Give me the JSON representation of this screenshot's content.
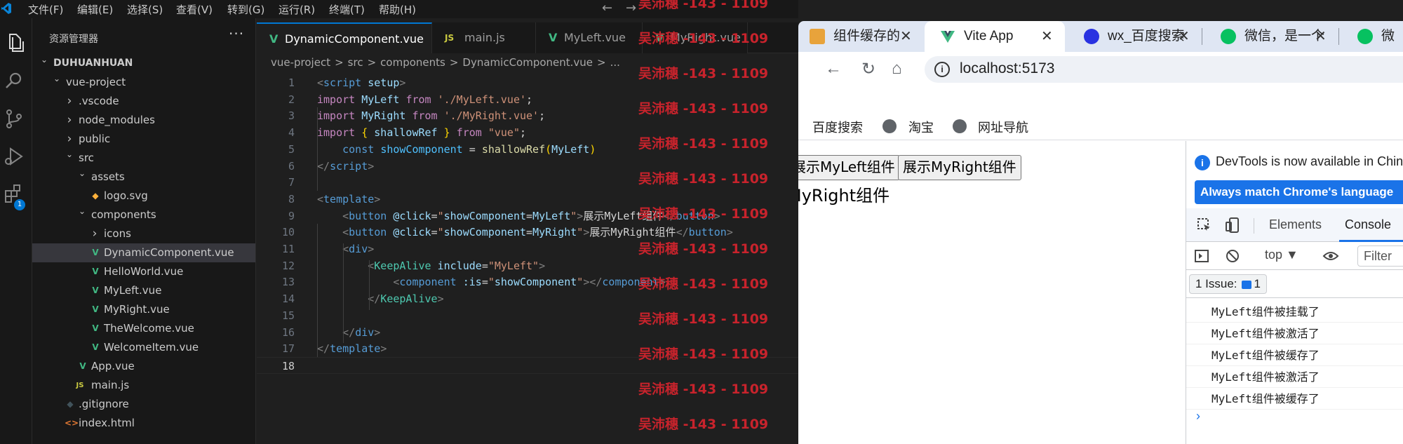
{
  "vscode": {
    "menu": [
      "文件(F)",
      "编辑(E)",
      "选择(S)",
      "查看(V)",
      "转到(G)",
      "运行(R)",
      "终端(T)",
      "帮助(H)"
    ],
    "extensions_badge": "1",
    "explorer": {
      "title": "资源管理器",
      "more": "···",
      "tree": [
        {
          "label": "DUHUANHUAN",
          "depth": 0,
          "kind": "folder-open",
          "bold": true
        },
        {
          "label": "vue-project",
          "depth": 1,
          "kind": "folder-open"
        },
        {
          "label": ".vscode",
          "depth": 2,
          "kind": "folder"
        },
        {
          "label": "node_modules",
          "depth": 2,
          "kind": "folder"
        },
        {
          "label": "public",
          "depth": 2,
          "kind": "folder"
        },
        {
          "label": "src",
          "depth": 2,
          "kind": "folder-open"
        },
        {
          "label": "assets",
          "depth": 3,
          "kind": "folder-open"
        },
        {
          "label": "logo.svg",
          "depth": 4,
          "kind": "svg"
        },
        {
          "label": "components",
          "depth": 3,
          "kind": "folder-open"
        },
        {
          "label": "icons",
          "depth": 4,
          "kind": "folder"
        },
        {
          "label": "DynamicComponent.vue",
          "depth": 4,
          "kind": "vue",
          "selected": true
        },
        {
          "label": "HelloWorld.vue",
          "depth": 4,
          "kind": "vue"
        },
        {
          "label": "MyLeft.vue",
          "depth": 4,
          "kind": "vue"
        },
        {
          "label": "MyRight.vue",
          "depth": 4,
          "kind": "vue"
        },
        {
          "label": "TheWelcome.vue",
          "depth": 4,
          "kind": "vue"
        },
        {
          "label": "WelcomeItem.vue",
          "depth": 4,
          "kind": "vue"
        },
        {
          "label": "App.vue",
          "depth": 3,
          "kind": "vue"
        },
        {
          "label": "main.js",
          "depth": 3,
          "kind": "js"
        },
        {
          "label": ".gitignore",
          "depth": 2,
          "kind": "git"
        },
        {
          "label": "index.html",
          "depth": 2,
          "kind": "html"
        }
      ]
    },
    "tabs": [
      {
        "label": "DynamicComponent.vue",
        "kind": "vue",
        "active": true
      },
      {
        "label": "main.js",
        "kind": "js"
      },
      {
        "label": "MyLeft.vue",
        "kind": "vue"
      },
      {
        "label": "MyRight.vue",
        "kind": "vue"
      }
    ],
    "breadcrumb": [
      "vue-project",
      ">",
      "src",
      ">",
      "components",
      ">",
      "DynamicComponent.vue",
      ">",
      "..."
    ],
    "current_line": 18,
    "code": [
      [
        [
          "<",
          "tk-pun"
        ],
        [
          "script",
          "tk-tag"
        ],
        [
          " ",
          "tk-txt"
        ],
        [
          "setup",
          "tk-id"
        ],
        [
          ">",
          "tk-pun"
        ]
      ],
      [
        [
          "import",
          "tk-kw"
        ],
        [
          " ",
          "tk-txt"
        ],
        [
          "MyLeft",
          "tk-id"
        ],
        [
          " ",
          "tk-txt"
        ],
        [
          "from",
          "tk-kw"
        ],
        [
          " ",
          "tk-txt"
        ],
        [
          "'./MyLeft.vue'",
          "tk-str"
        ],
        [
          ";",
          "tk-txt"
        ]
      ],
      [
        [
          "import",
          "tk-kw"
        ],
        [
          " ",
          "tk-txt"
        ],
        [
          "MyRight",
          "tk-id"
        ],
        [
          " ",
          "tk-txt"
        ],
        [
          "from",
          "tk-kw"
        ],
        [
          " ",
          "tk-txt"
        ],
        [
          "'./MyRight.vue'",
          "tk-str"
        ],
        [
          ";",
          "tk-txt"
        ]
      ],
      [
        [
          "import",
          "tk-kw"
        ],
        [
          " ",
          "tk-txt"
        ],
        [
          "{",
          "tk-br"
        ],
        [
          " ",
          "tk-txt"
        ],
        [
          "shallowRef",
          "tk-id"
        ],
        [
          " ",
          "tk-txt"
        ],
        [
          "}",
          "tk-br"
        ],
        [
          " ",
          "tk-txt"
        ],
        [
          "from",
          "tk-kw"
        ],
        [
          " ",
          "tk-txt"
        ],
        [
          "\"vue\"",
          "tk-str"
        ],
        [
          ";",
          "tk-txt"
        ]
      ],
      [
        [
          "    ",
          "tk-txt"
        ],
        [
          "const",
          "tk-dec"
        ],
        [
          " ",
          "tk-txt"
        ],
        [
          "showComponent",
          "tk-const"
        ],
        [
          " = ",
          "tk-txt"
        ],
        [
          "shallowRef",
          "tk-fn"
        ],
        [
          "(",
          "tk-br"
        ],
        [
          "MyLeft",
          "tk-id"
        ],
        [
          ")",
          "tk-br"
        ]
      ],
      [
        [
          "</",
          "tk-pun"
        ],
        [
          "script",
          "tk-tag"
        ],
        [
          ">",
          "tk-pun"
        ]
      ],
      [],
      [
        [
          "<",
          "tk-pun"
        ],
        [
          "template",
          "tk-tag"
        ],
        [
          ">",
          "tk-pun"
        ]
      ],
      [
        [
          "    ",
          "tk-txt"
        ],
        [
          "<",
          "tk-pun"
        ],
        [
          "button",
          "tk-tag"
        ],
        [
          " ",
          "tk-txt"
        ],
        [
          "@click",
          "tk-id"
        ],
        [
          "=",
          "tk-txt"
        ],
        [
          "\"",
          "tk-str"
        ],
        [
          "showComponent",
          "tk-id"
        ],
        [
          "=",
          "tk-txt"
        ],
        [
          "MyLeft",
          "tk-id"
        ],
        [
          "\"",
          "tk-str"
        ],
        [
          ">",
          "tk-pun"
        ],
        [
          "展示MyLeft组件",
          "tk-txt"
        ],
        [
          "</",
          "tk-pun"
        ],
        [
          "button",
          "tk-tag"
        ],
        [
          ">",
          "tk-pun"
        ]
      ],
      [
        [
          "    ",
          "tk-txt"
        ],
        [
          "<",
          "tk-pun"
        ],
        [
          "button",
          "tk-tag"
        ],
        [
          " ",
          "tk-txt"
        ],
        [
          "@click",
          "tk-id"
        ],
        [
          "=",
          "tk-txt"
        ],
        [
          "\"",
          "tk-str"
        ],
        [
          "showComponent",
          "tk-id"
        ],
        [
          "=",
          "tk-txt"
        ],
        [
          "MyRight",
          "tk-id"
        ],
        [
          "\"",
          "tk-str"
        ],
        [
          ">",
          "tk-pun"
        ],
        [
          "展示MyRight组件",
          "tk-txt"
        ],
        [
          "</",
          "tk-pun"
        ],
        [
          "button",
          "tk-tag"
        ],
        [
          ">",
          "tk-pun"
        ]
      ],
      [
        [
          "    ",
          "tk-txt"
        ],
        [
          "<",
          "tk-pun"
        ],
        [
          "div",
          "tk-tag"
        ],
        [
          ">",
          "tk-pun"
        ]
      ],
      [
        [
          "        ",
          "tk-txt"
        ],
        [
          "<",
          "tk-pun"
        ],
        [
          "KeepAlive",
          "tk-cmp"
        ],
        [
          " ",
          "tk-txt"
        ],
        [
          "include",
          "tk-id"
        ],
        [
          "=",
          "tk-txt"
        ],
        [
          "\"MyLeft\"",
          "tk-str"
        ],
        [
          ">",
          "tk-pun"
        ]
      ],
      [
        [
          "            ",
          "tk-txt"
        ],
        [
          "<",
          "tk-pun"
        ],
        [
          "component",
          "tk-tag"
        ],
        [
          " ",
          "tk-txt"
        ],
        [
          ":is",
          "tk-id"
        ],
        [
          "=",
          "tk-txt"
        ],
        [
          "\"",
          "tk-str"
        ],
        [
          "showComponent",
          "tk-id"
        ],
        [
          "\"",
          "tk-str"
        ],
        [
          "></",
          "tk-pun"
        ],
        [
          "component",
          "tk-tag"
        ],
        [
          ">",
          "tk-pun"
        ]
      ],
      [
        [
          "        ",
          "tk-txt"
        ],
        [
          "</",
          "tk-pun"
        ],
        [
          "KeepAlive",
          "tk-cmp"
        ],
        [
          ">",
          "tk-pun"
        ]
      ],
      [],
      [
        [
          "    ",
          "tk-txt"
        ],
        [
          "</",
          "tk-pun"
        ],
        [
          "div",
          "tk-tag"
        ],
        [
          ">",
          "tk-pun"
        ]
      ],
      [
        [
          "</",
          "tk-pun"
        ],
        [
          "template",
          "tk-tag"
        ],
        [
          ">",
          "tk-pun"
        ]
      ],
      []
    ]
  },
  "watermark": "吴沛穗 -143 - 1109",
  "browser": {
    "tabs": [
      {
        "label": "组件缓存的",
        "icon": "orange"
      },
      {
        "label": "Vite App",
        "icon": "vue",
        "active": true
      },
      {
        "label": "wx_百度搜索",
        "icon": "baidu"
      },
      {
        "label": "微信，是一个",
        "icon": "wechat"
      },
      {
        "label": "微",
        "icon": "wechat"
      }
    ],
    "close": "✕",
    "url": "localhost:5173",
    "bookmarks": [
      "百度搜索",
      "淘宝",
      "网址导航"
    ],
    "page": {
      "btn_left": "展示MyLeft组件",
      "btn_right": "展示MyRight组件",
      "text": "MyRight组件"
    },
    "devtools": {
      "notice": "DevTools is now available in Chinese",
      "lang_button": "Always match Chrome's language",
      "tab_elements": "Elements",
      "tab_console": "Console",
      "context": "top ▼",
      "filter": "Filter",
      "issues_label": "1 Issue:",
      "issues_count": "1",
      "logs": [
        "MyLeft组件被挂载了",
        "MyLeft组件被激活了",
        "MyLeft组件被缓存了",
        "MyLeft组件被激活了",
        "MyLeft组件被缓存了"
      ],
      "prompt": "›"
    }
  },
  "colors": {
    "vue_green": "#41b883",
    "js_yellow": "#cbcb41",
    "accent": "#0078d4",
    "chrome_blue": "#1a73e8",
    "watermark": "#c8232c"
  }
}
